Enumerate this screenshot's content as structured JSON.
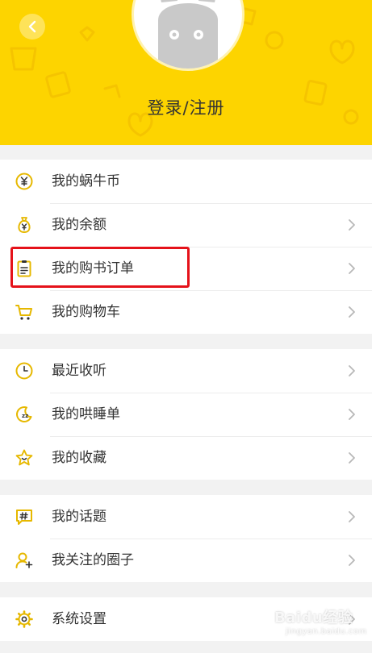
{
  "header": {
    "login_label": "登录/注册",
    "background_color": "#fdd400"
  },
  "icons": {
    "back": "chevron-left-icon",
    "chevron": "chevron-right-icon"
  },
  "menu": {
    "group1": [
      {
        "label": "我的蜗牛币",
        "icon": "yuan-coin-icon"
      },
      {
        "label": "我的余额",
        "icon": "money-bag-icon"
      },
      {
        "label": "我的购书订单",
        "icon": "order-list-icon"
      },
      {
        "label": "我的购物车",
        "icon": "shopping-cart-icon"
      }
    ],
    "group2": [
      {
        "label": "最近收听",
        "icon": "clock-icon"
      },
      {
        "label": "我的哄睡单",
        "icon": "moon-sleep-icon"
      },
      {
        "label": "我的收藏",
        "icon": "star-icon"
      }
    ],
    "group3": [
      {
        "label": "我的话题",
        "icon": "hashtag-icon"
      },
      {
        "label": "我关注的圈子",
        "icon": "user-add-icon"
      }
    ],
    "group4": [
      {
        "label": "系统设置",
        "icon": "gear-icon"
      }
    ]
  },
  "watermark": {
    "text": "Baidu经验",
    "sub": "jingyan.baidu.com"
  },
  "colors": {
    "accent": "#fdd400",
    "icon": "#e6b800",
    "highlight": "#e5121a"
  }
}
